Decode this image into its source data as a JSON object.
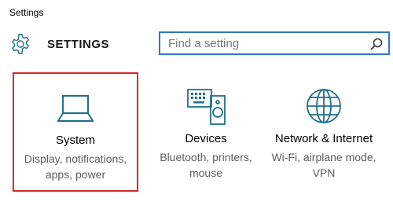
{
  "window": {
    "title": "Settings"
  },
  "header": {
    "heading": "SETTINGS",
    "icon": "gear-icon"
  },
  "search": {
    "placeholder": "Find a setting",
    "value": "",
    "icon": "search-icon"
  },
  "tiles": [
    {
      "name": "System",
      "desc_line1": "Display, notifications,",
      "desc_line2": "apps, power",
      "icon": "laptop-icon",
      "selected": true
    },
    {
      "name": "Devices",
      "desc_line1": "Bluetooth, printers,",
      "desc_line2": "mouse",
      "icon": "keyboard-speaker-icon",
      "selected": false
    },
    {
      "name": "Network & Internet",
      "desc_line1": "Wi-Fi, airplane mode,",
      "desc_line2": "VPN",
      "icon": "globe-icon",
      "selected": false
    }
  ],
  "colors": {
    "accent": "#2b79c2",
    "icon": "#1f6f8b",
    "selection": "#d9282e"
  }
}
